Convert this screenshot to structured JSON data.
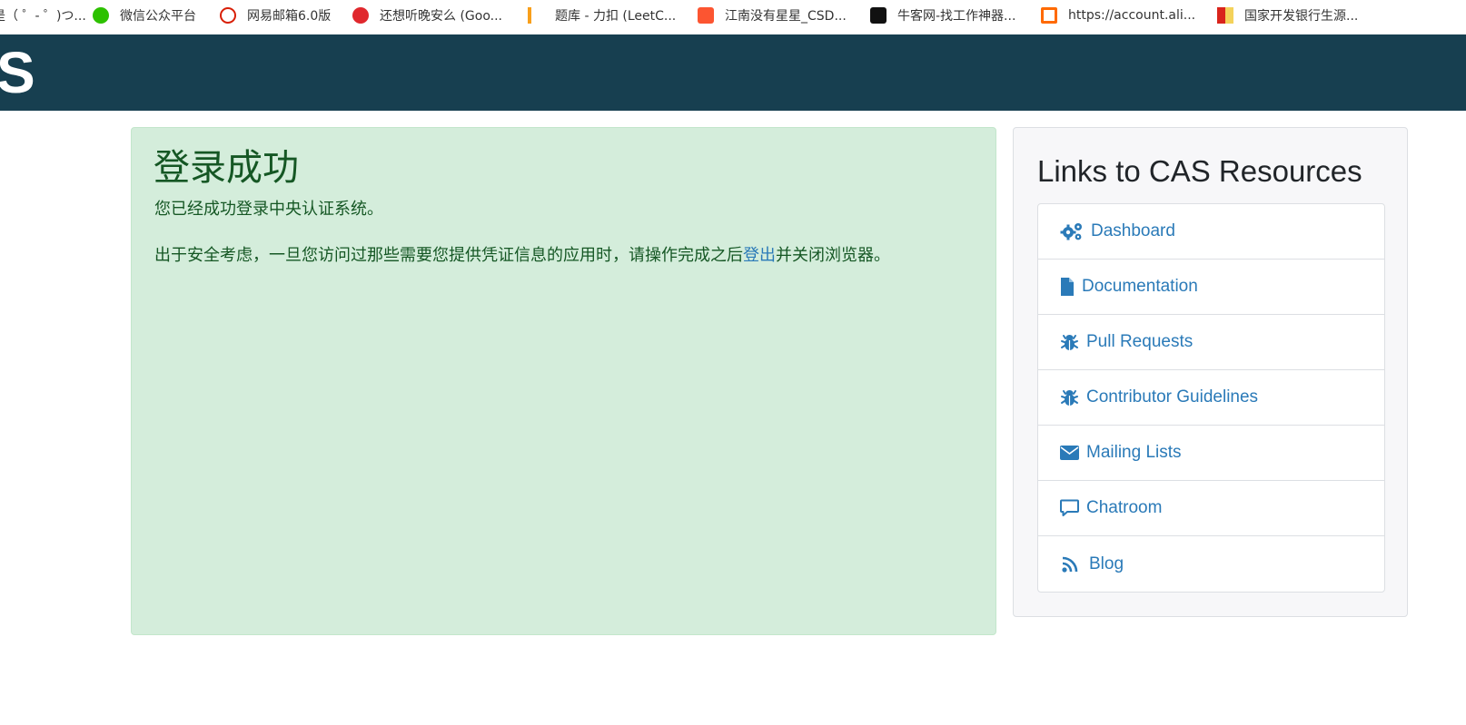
{
  "bookmarks": [
    {
      "label": "是（ ゜- ゜)つ...",
      "icon": "bookmark-icon",
      "color": "#ffffff"
    },
    {
      "label": "微信公众平台",
      "icon": "wechat-icon",
      "color": "#2dc100"
    },
    {
      "label": "网易邮箱6.0版",
      "icon": "netease-mail-icon",
      "color": "#d81e06"
    },
    {
      "label": "还想听晚安么 (Goo...",
      "icon": "ig-icon",
      "color": "#e0282d"
    },
    {
      "label": "题库 - 力扣 (LeetC...",
      "icon": "leetcode-icon",
      "color": "#f89f1b"
    },
    {
      "label": "江南没有星星_CSD...",
      "icon": "csdn-icon",
      "color": "#fc5531"
    },
    {
      "label": "牛客网-找工作神器...",
      "icon": "nowcoder-icon",
      "color": "#111111"
    },
    {
      "label": "https://account.ali...",
      "icon": "aliyun-icon",
      "color": "#ff6a00"
    },
    {
      "label": "国家开发银行生源...",
      "icon": "cdb-icon",
      "color": "#d9241c"
    }
  ],
  "header": {
    "logo_text": "S"
  },
  "success": {
    "title": "登录成功",
    "message": "您已经成功登录中央认证系统。",
    "warning_before": "出于安全考虑，一旦您访问过那些需要您提供凭证信息的应用时，请操作完成之后",
    "logout_link": "登出",
    "warning_after": "并关闭浏览器。"
  },
  "resources": {
    "title": "Links to CAS Resources",
    "items": [
      {
        "label": "Dashboard",
        "icon": "gears-icon"
      },
      {
        "label": "Documentation",
        "icon": "file-icon"
      },
      {
        "label": "Pull Requests",
        "icon": "bug-icon"
      },
      {
        "label": "Contributor Guidelines",
        "icon": "bug-icon"
      },
      {
        "label": "Mailing Lists",
        "icon": "envelope-icon"
      },
      {
        "label": "Chatroom",
        "icon": "comment-icon"
      },
      {
        "label": "Blog",
        "icon": "rss-icon"
      }
    ]
  },
  "colors": {
    "header_bg": "#173f50",
    "success_bg": "#d4eddb",
    "success_text": "#155724",
    "link": "#2a7ab8"
  }
}
